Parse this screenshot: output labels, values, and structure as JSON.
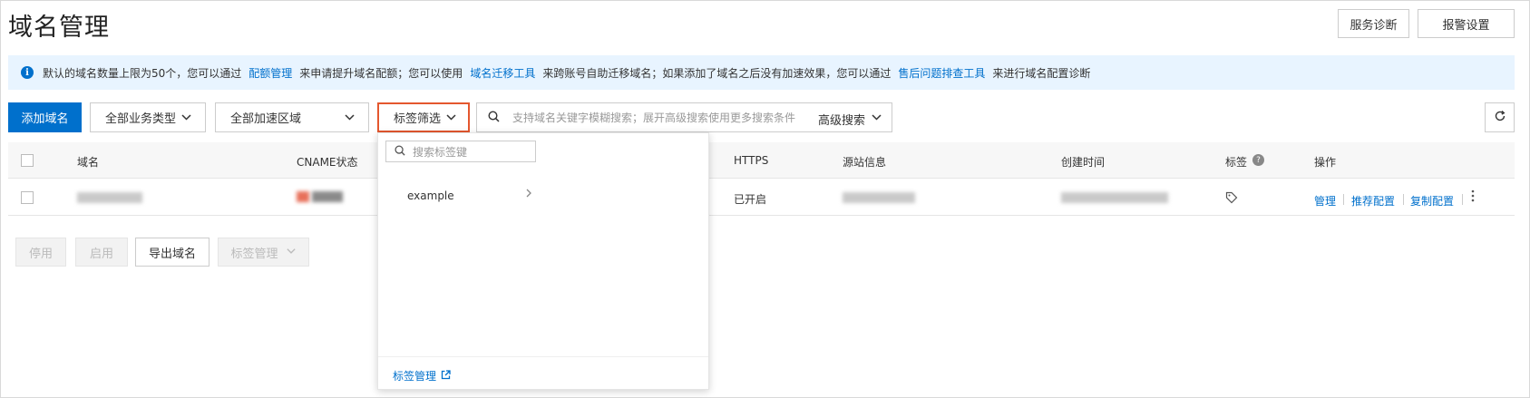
{
  "header": {
    "title": "域名管理",
    "service_diagnose": "服务诊断",
    "alarm_settings": "报警设置"
  },
  "notice": {
    "text1": "默认的域名数量上限为50个，您可以通过",
    "link1": "配额管理",
    "text2": "来申请提升域名配额；您可以使用",
    "link2": "域名迁移工具",
    "text3": "来跨账号自助迁移域名；如果添加了域名之后没有加速效果，您可以通过",
    "link3": "售后问题排查工具",
    "text4": "来进行域名配置诊断"
  },
  "toolbar": {
    "add_domain": "添加域名",
    "business_type": "全部业务类型",
    "region": "全部加速区域",
    "tag_filter": "标签筛选",
    "search_placeholder": "支持域名关键字模糊搜索；展开高级搜索使用更多搜索条件",
    "advanced_search": "高级搜索"
  },
  "table": {
    "headers": {
      "domain": "域名",
      "cname": "CNAME状态",
      "https": "HTTPS",
      "origin": "源站信息",
      "created": "创建时间",
      "tag": "标签",
      "actions": "操作"
    },
    "rows": [
      {
        "https": "已开启",
        "action_manage": "管理",
        "action_recommend": "推荐配置",
        "action_copy": "复制配置"
      }
    ]
  },
  "bottom_actions": {
    "disable": "停用",
    "enable": "启用",
    "export": "导出域名",
    "tag_manage": "标签管理"
  },
  "dropdown": {
    "search_placeholder": "搜索标签键",
    "items": [
      "example"
    ],
    "footer_link": "标签管理"
  },
  "colors": {
    "primary": "#0070cc",
    "notice_bg": "#e8f4ff",
    "highlight_border": "#e4572e"
  }
}
